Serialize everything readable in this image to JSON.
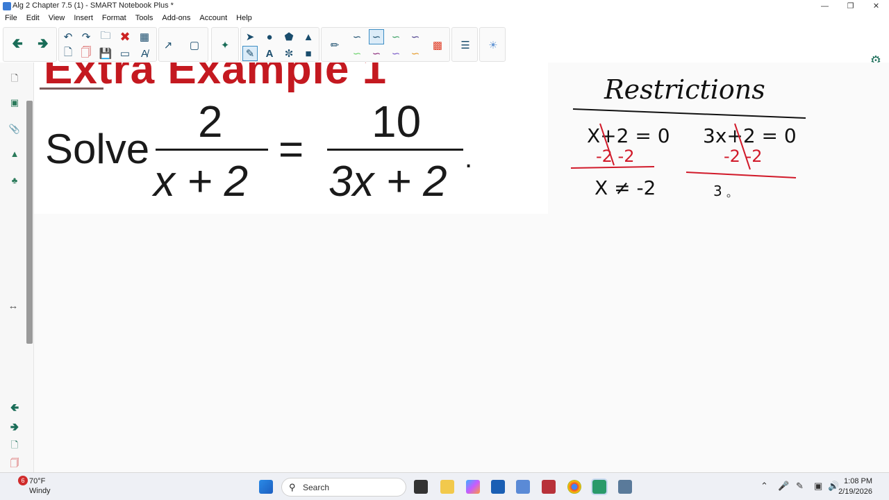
{
  "window": {
    "title": "Alg 2 Chapter 7.5 (1) - SMART Notebook Plus *",
    "minimize": "—",
    "restore": "❐",
    "close": "✕"
  },
  "menu": [
    "File",
    "Edit",
    "View",
    "Insert",
    "Format",
    "Tools",
    "Add-ons",
    "Account",
    "Help"
  ],
  "slide": {
    "heading": "Extra Example 1",
    "solve_label": "Solve",
    "frac1_num": "2",
    "frac1_den": "x + 2",
    "equals": "=",
    "frac2_num": "10",
    "frac2_den": "3x + 2",
    "period": "."
  },
  "handwriting": {
    "title": "Restrictions",
    "eq1": "X+2 = 0",
    "eq1_sub": "-2   -2",
    "eq1_result": "X ≠ -2",
    "eq2": "3x+2 = 0",
    "eq2_sub": "-2   -2",
    "eq2_partial": "3"
  },
  "taskbar": {
    "weather_temp": "70°F",
    "weather_desc": "Windy",
    "weather_badge": "6",
    "search_placeholder": "Search",
    "time": "1:08 PM",
    "date": "2/19/2026"
  },
  "colors": {
    "accent_green": "#1a6d58",
    "heading_red": "#c41920",
    "ink_red": "#d11a2a",
    "ink_black": "#111111"
  }
}
